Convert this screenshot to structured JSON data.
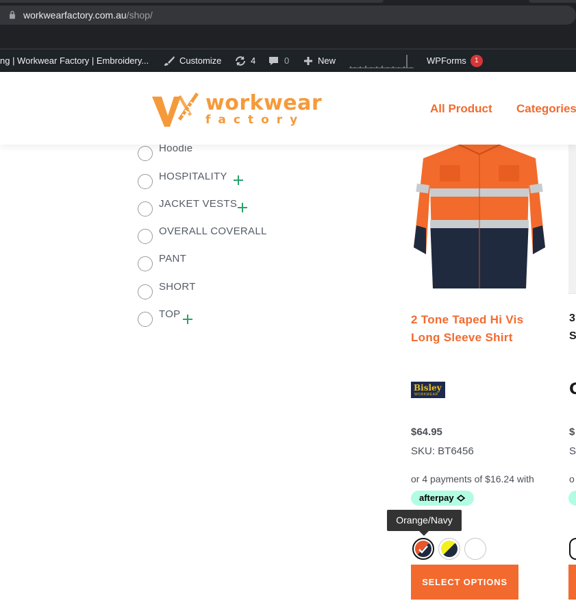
{
  "browser": {
    "url_domain": "workwearfactory.com.au",
    "url_path": "/shop/"
  },
  "admin_bar": {
    "site_title": "ng | Workwear Factory | Embroidery...",
    "customize_label": "Customize",
    "updates_count": "4",
    "comments_count": "0",
    "new_label": "New",
    "wpforms_label": "WPForms",
    "wpforms_badge": "1"
  },
  "header": {
    "logo_word1": "workwear",
    "logo_word2": "factory",
    "nav": [
      "All Product",
      "Categories"
    ]
  },
  "filters": {
    "items": [
      {
        "label": "Hoodie",
        "expandable": false
      },
      {
        "label": "HOSPITALITY",
        "expandable": true
      },
      {
        "label": "JACKET VESTS",
        "expandable": true
      },
      {
        "label": "OVERALL COVERALL",
        "expandable": false
      },
      {
        "label": "PANT",
        "expandable": false
      },
      {
        "label": "SHORT",
        "expandable": false
      },
      {
        "label": "TOP",
        "expandable": true
      }
    ]
  },
  "product": {
    "title": "2 Tone Taped Hi Vis Long Sleeve Shirt",
    "brand": "Bisley",
    "brand_sub": "WORKWEAR",
    "price": "$64.95",
    "sku": "SKU: BT6456",
    "afterpay_text": "or 4 payments of $16.24 with",
    "afterpay_label": "afterpay",
    "tooltip": "Orange/Navy",
    "swatches": [
      {
        "name": "Orange/Navy",
        "colors": [
          "#e8562a",
          "#1f2a3f"
        ],
        "selected": true
      },
      {
        "name": "Yellow/Navy",
        "colors": [
          "#f3f01e",
          "#1f2a3f"
        ],
        "selected": false
      },
      {
        "name": "White",
        "colors": [
          "#ffffff",
          "#ffffff"
        ],
        "selected": false
      }
    ],
    "button_label": "SELECT OPTIONS"
  },
  "next_product": {
    "title_line1": "3",
    "title_line2": "S",
    "brand_initial": "C",
    "price_partial": "$",
    "sku_partial": "S",
    "afterpay_partial": "o"
  },
  "colors": {
    "accent_orange": "#f26a2e",
    "logo_orange": "#f59a3a",
    "plus_green": "#27a36b",
    "afterpay_mint": "#b2fce4",
    "admin_bar": "#1d2327"
  }
}
